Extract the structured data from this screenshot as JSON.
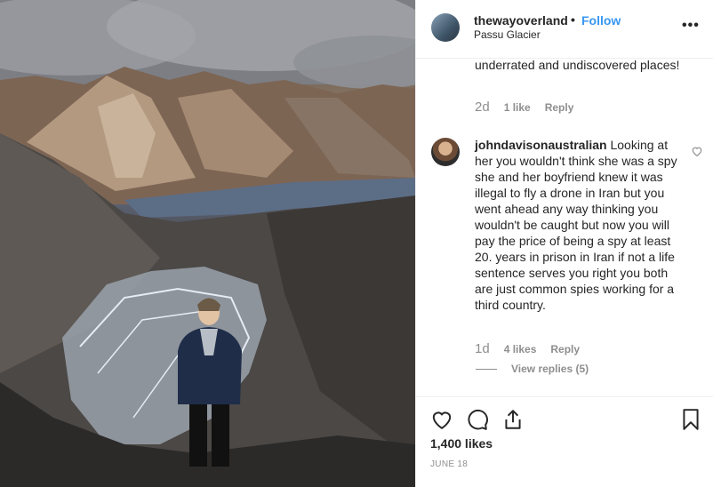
{
  "post": {
    "username": "thewayoverland",
    "separator": "•",
    "follow_label": "Follow",
    "location": "Passu Glacier",
    "more_label": "•••"
  },
  "comments": {
    "previous": {
      "text": "underrated and undiscovered places!",
      "time": "2d",
      "likes": "1 like",
      "reply_label": "Reply"
    },
    "main": {
      "username": "johndavisonaustralian",
      "text": "Looking at her you wouldn't think she was a spy she and her boyfriend knew it was illegal to fly a drone in Iran but you went ahead any way thinking you wouldn't be caught but now you will pay the price of being a spy at least 20. years in prison in Iran if not a life sentence serves you right you both are just common spies working for a third country.",
      "time": "1d",
      "likes": "4 likes",
      "reply_label": "Reply",
      "view_replies": "View replies (5)"
    }
  },
  "footer": {
    "likes_count": "1,400 likes",
    "date": "JUNE 18"
  },
  "icons": {
    "like": "heart-icon",
    "comment": "comment-icon",
    "share": "share-icon",
    "save": "bookmark-icon",
    "comment_like": "heart-icon"
  },
  "colors": {
    "accent": "#3897f0",
    "secondary_text": "#8e8e8e",
    "divider": "#efefef"
  }
}
